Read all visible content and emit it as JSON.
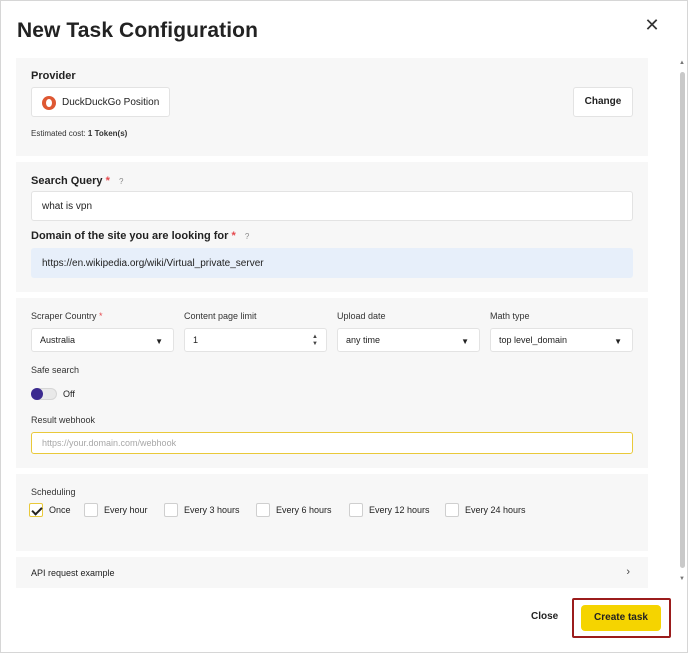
{
  "dialog": {
    "title": "New Task Configuration",
    "close_icon": "close-icon"
  },
  "provider": {
    "label": "Provider",
    "name": "DuckDuckGo Position",
    "icon": "duckduckgo-logo-icon",
    "change_label": "Change",
    "cost_prefix": "Estimated cost:",
    "cost_value": "1 Token(s)"
  },
  "query": {
    "label": "Search Query",
    "required_mark": "*",
    "help": "?",
    "value": "what is vpn"
  },
  "domain": {
    "label": "Domain of the site you are looking for",
    "required_mark": "*",
    "help": "?",
    "value": "https://en.wikipedia.org/wiki/Virtual_private_server"
  },
  "options": {
    "country_label": "Scraper Country",
    "country_required": "*",
    "country_value": "Australia",
    "page_limit_label": "Content page limit",
    "page_limit_value": "1",
    "upload_label": "Upload date",
    "upload_value": "any time",
    "math_label": "Math type",
    "math_value": "top level_domain",
    "safe_label": "Safe search",
    "safe_value": "Off",
    "webhook_label": "Result webhook",
    "webhook_placeholder": "https://your.domain.com/webhook"
  },
  "scheduling": {
    "label": "Scheduling",
    "items": [
      {
        "label": "Once",
        "checked": true
      },
      {
        "label": "Every hour",
        "checked": false
      },
      {
        "label": "Every 3 hours",
        "checked": false
      },
      {
        "label": "Every 6 hours",
        "checked": false
      },
      {
        "label": "Every 12 hours",
        "checked": false
      },
      {
        "label": "Every 24 hours",
        "checked": false
      }
    ]
  },
  "api": {
    "label": "API request example"
  },
  "footer": {
    "close_label": "Close",
    "create_label": "Create task"
  },
  "colors": {
    "accent_yellow": "#f5d400",
    "toggle_knob": "#3b2a8f",
    "required_red": "#e5484d",
    "highlight_border": "#9b1c1c"
  }
}
